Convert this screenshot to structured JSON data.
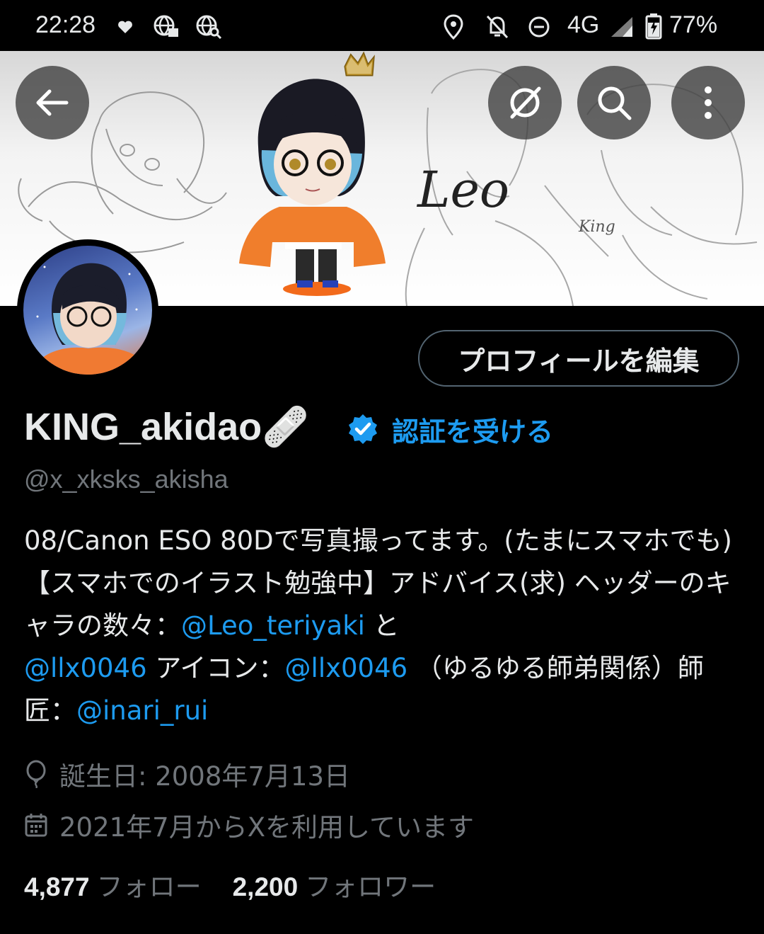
{
  "status_bar": {
    "time": "22:28",
    "network": "4G",
    "battery": "77%"
  },
  "header": {
    "banner_signature": "Leo"
  },
  "profile": {
    "edit_button_label": "プロフィールを編集",
    "display_name": "KING_akidao🩹",
    "verify_label": "認証を受ける",
    "handle": "@x_xksks_akisha",
    "bio": {
      "part1": "08/Canon ESO 80Dで写真撮ってます。(たまにスマホでも)【スマホでのイラスト勉強中】アドバイス(求) ヘッダーのキャラの数々：",
      "mention1": "@Leo_teriyaki",
      "part2": " と ",
      "mention2": "@llx0046",
      "part3": " アイコン：",
      "mention3": "@llx0046",
      "part4": " （ゆるゆる師弟関係）師匠：",
      "mention4": "@inari_rui"
    },
    "birthday": "誕生日: 2008年7月13日",
    "joined": "2021年7月からXを利用しています",
    "following_count": "4,877",
    "following_label": "フォロー",
    "followers_count": "2,200",
    "followers_label": "フォロワー"
  },
  "icons": {
    "back": "arrow-left-icon",
    "grok": "grok-icon",
    "search": "search-icon",
    "more": "more-vertical-icon",
    "verified": "verified-badge-icon",
    "birthday": "balloon-icon",
    "calendar": "calendar-icon"
  },
  "colors": {
    "accent": "#1d9bf0",
    "muted": "#71767b",
    "text": "#e7e9ea",
    "background": "#000000"
  }
}
